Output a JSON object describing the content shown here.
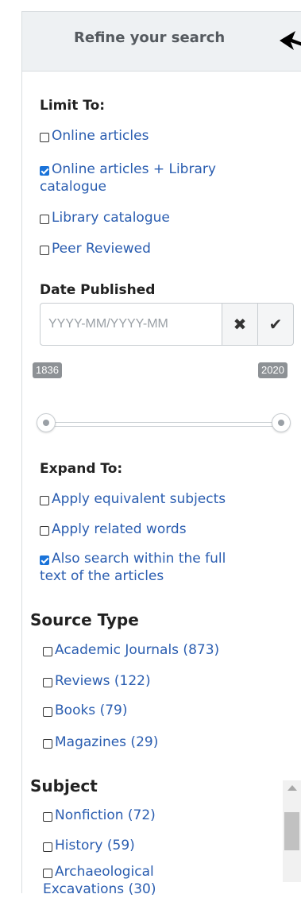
{
  "header": {
    "title": "Refine your search"
  },
  "limit_to": {
    "heading": "Limit To:",
    "options": [
      {
        "line1": "Online articles",
        "line2": "",
        "checked": false
      },
      {
        "line1": "Online articles + Library",
        "line2": "catalogue",
        "checked": true
      },
      {
        "line1": "Library catalogue",
        "line2": "",
        "checked": false
      },
      {
        "line1": "Peer Reviewed",
        "line2": "",
        "checked": false
      }
    ]
  },
  "date_published": {
    "heading": "Date Published",
    "placeholder": "YYYY-MM/YYYY-MM",
    "clear_icon": "✖",
    "apply_icon": "✔",
    "range_min": "1836",
    "range_max": "2020"
  },
  "expand_to": {
    "heading": "Expand To:",
    "options": [
      {
        "line1": "Apply equivalent subjects",
        "line2": "",
        "checked": false
      },
      {
        "line1": "Apply related words",
        "line2": "",
        "checked": false
      },
      {
        "line1": "Also search within the full",
        "line2": "text of the articles",
        "checked": true
      }
    ]
  },
  "source_type": {
    "heading": "Source Type",
    "options": [
      {
        "label": "Academic Journals (873)",
        "checked": false
      },
      {
        "label": "Reviews (122)",
        "checked": false
      },
      {
        "label": "Books (79)",
        "checked": false
      },
      {
        "label": "Magazines (29)",
        "checked": false
      }
    ]
  },
  "subject": {
    "heading": "Subject",
    "options": [
      {
        "label": "Nonfiction (72)",
        "checked": false
      },
      {
        "label": "History (59)",
        "checked": false
      },
      {
        "line1": "Archaeological",
        "line2": "Excavations (30)",
        "checked": false
      }
    ]
  },
  "colors": {
    "link": "#2a5db0",
    "checkbox_checked": "#1a73d9",
    "header_bg": "#eef1f3",
    "badge_bg": "#8d9195"
  }
}
